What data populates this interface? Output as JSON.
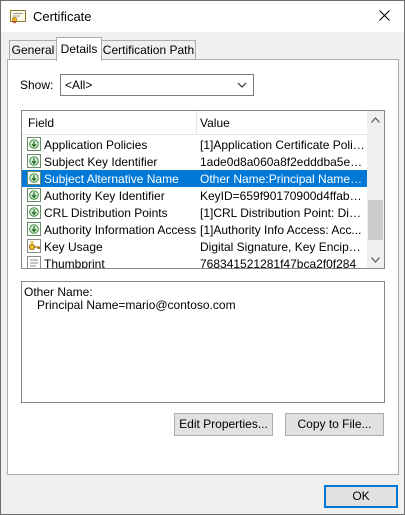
{
  "window": {
    "title": "Certificate"
  },
  "tabs": [
    {
      "label": "General"
    },
    {
      "label": "Details"
    },
    {
      "label": "Certification Path"
    }
  ],
  "show": {
    "label": "Show:",
    "value": "<All>"
  },
  "columns": {
    "field": "Field",
    "value": "Value"
  },
  "rows": [
    {
      "field": "Application Policies",
      "value": "[1]Application Certificate Polic...",
      "icon": "cert-ext-icon"
    },
    {
      "field": "Subject Key Identifier",
      "value": "1ade0d8a060a8f2edddba5ed...",
      "icon": "cert-ext-icon"
    },
    {
      "field": "Subject Alternative Name",
      "value": "Other Name:Principal Name=m...",
      "icon": "cert-ext-icon"
    },
    {
      "field": "Authority Key Identifier",
      "value": "KeyID=659f90170900d4ffab8...",
      "icon": "cert-ext-icon"
    },
    {
      "field": "CRL Distribution Points",
      "value": "[1]CRL Distribution Point: Distr...",
      "icon": "cert-ext-icon"
    },
    {
      "field": "Authority Information Access",
      "value": "[1]Authority Info Access: Acc...",
      "icon": "cert-ext-icon"
    },
    {
      "field": "Key Usage",
      "value": "Digital Signature, Key Encipher...",
      "icon": "key-usage-icon"
    },
    {
      "field": "Thumbprint",
      "value": "768341521281f47bca2f0f284",
      "icon": "cert-prop-icon"
    }
  ],
  "detail": {
    "line1": "Other Name:",
    "line2": "Principal Name=mario@contoso.com"
  },
  "buttons": {
    "edit": "Edit Properties...",
    "copy": "Copy to File...",
    "ok": "OK"
  },
  "colors": {
    "selection": "#0078d7",
    "accent": "#0078d7"
  }
}
